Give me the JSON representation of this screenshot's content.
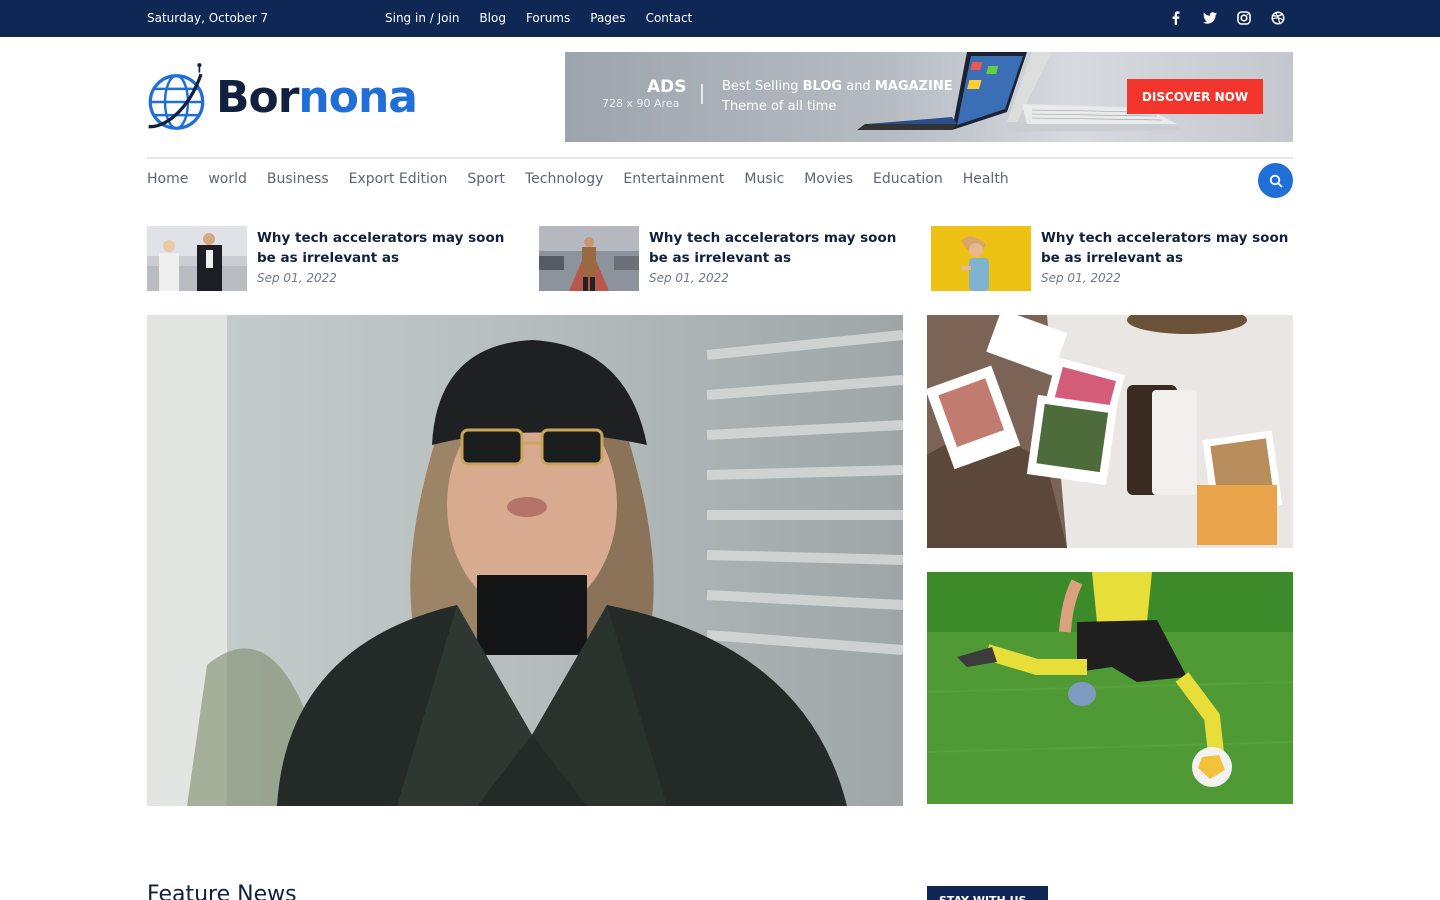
{
  "topbar": {
    "date": "Saturday, October 7",
    "links": [
      "Sing in / Join",
      "Blog",
      "Forums",
      "Pages",
      "Contact"
    ],
    "socials": [
      "facebook-icon",
      "twitter-icon",
      "instagram-icon",
      "dribbble-icon"
    ]
  },
  "logo": {
    "part1": "Bor",
    "part2": "nona"
  },
  "ad": {
    "label": "ADS",
    "size": "728 x 90 Area",
    "tagline_pre": "Best Selling ",
    "tagline_b1": "BLOG",
    "tagline_mid": " and ",
    "tagline_b2": "MAGAZINE",
    "tagline_line2": "Theme of all time",
    "cta": "DISCOVER NOW"
  },
  "nav": {
    "items": [
      "Home",
      "world",
      "Business",
      "Export Edition",
      "Sport",
      "Technology",
      "Entertainment",
      "Music",
      "Movies",
      "Education",
      "Health"
    ]
  },
  "posts": [
    {
      "title": "Why tech accelerators may soon be as irrelevant as",
      "date": "Sep 01, 2022"
    },
    {
      "title": "Why tech accelerators may soon be as irrelevant as",
      "date": "Sep 01, 2022"
    },
    {
      "title": "Why tech accelerators may soon be as irrelevant as",
      "date": "Sep 01, 2022"
    }
  ],
  "sections": {
    "feature_title": "Feature News",
    "stay_badge": "STAY WITH US"
  },
  "colors": {
    "topbar": "#0f2754",
    "accent": "#1f6fd6",
    "cta": "#f2362d"
  }
}
